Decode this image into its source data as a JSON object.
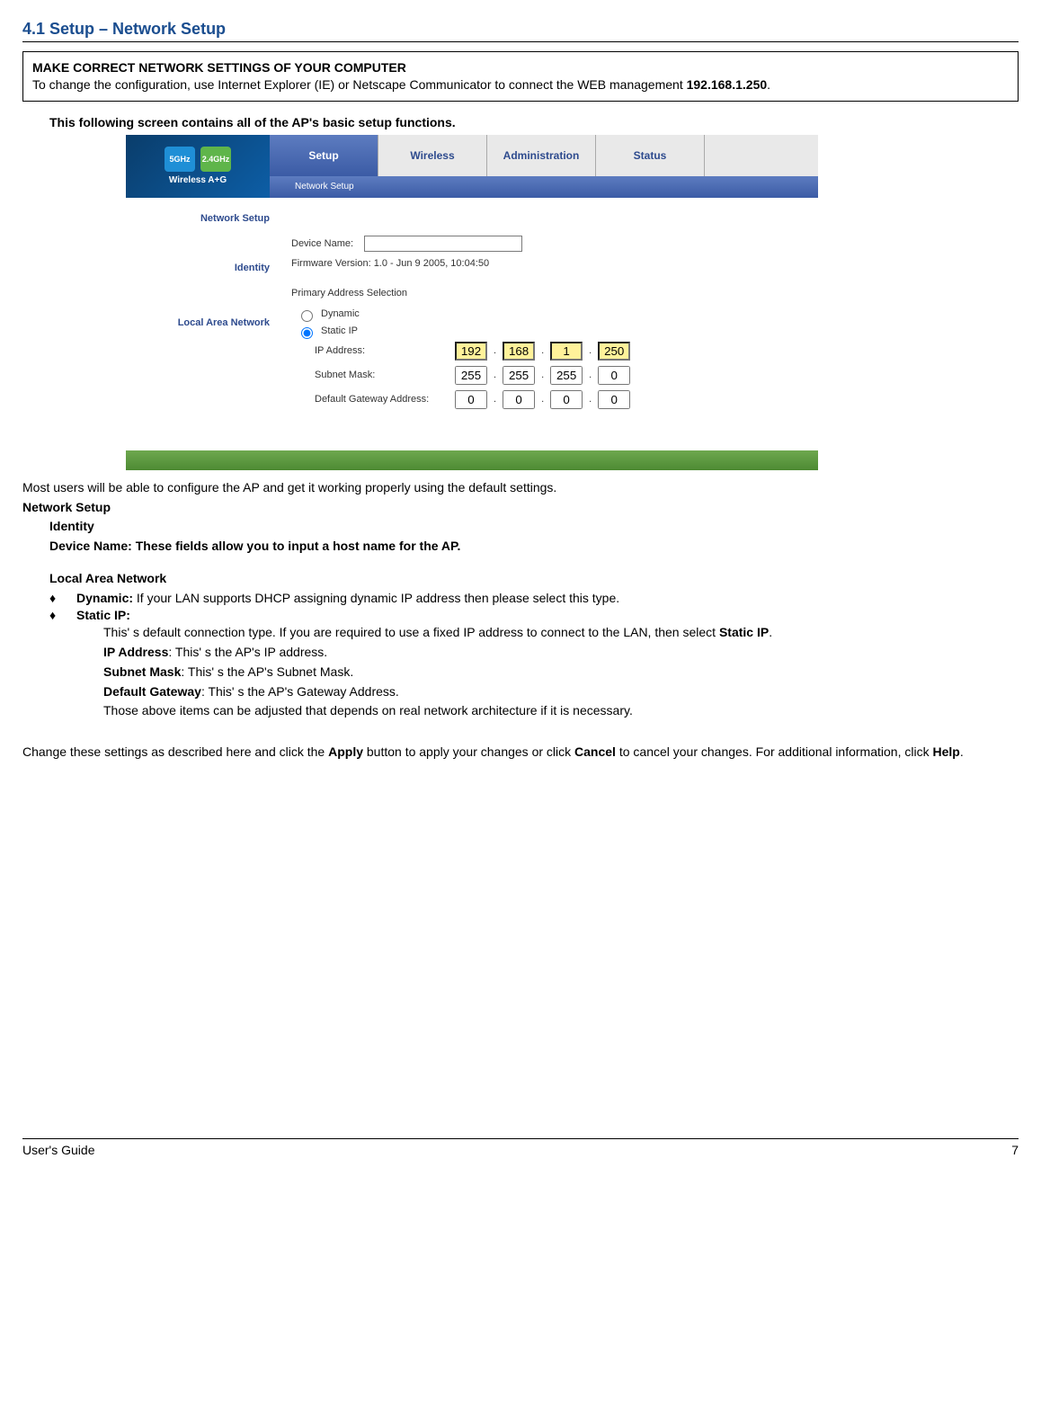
{
  "section_title": "4.1 Setup – Network Setup",
  "notice": {
    "heading": "MAKE CORRECT NETWORK SETTINGS OF YOUR COMPUTER",
    "body_pre": "To change the configuration, use Internet Explorer (IE) or Netscape Communicator to connect the WEB management ",
    "ip": "192.168.1.250",
    "body_post": "."
  },
  "intro_bold": "This following screen contains all of the AP's basic setup functions.",
  "ui": {
    "logo": {
      "flag1": "5GHz",
      "flag2": "2.4GHz",
      "txt": "Wireless A+G"
    },
    "tabs": {
      "setup": "Setup",
      "wireless": "Wireless",
      "admin": "Administration",
      "status": "Status"
    },
    "subtab": "Network Setup",
    "left": {
      "ns": "Network Setup",
      "id": "Identity",
      "lan": "Local Area Network"
    },
    "fields": {
      "device_name_lbl": "Device Name:",
      "fw_lbl": "Firmware Version: 1.0 - Jun 9 2005, 10:04:50",
      "pas": "Primary Address Selection",
      "dyn": "Dynamic",
      "stat": "Static IP",
      "ip_lbl": "IP Address:",
      "sm_lbl": "Subnet Mask:",
      "gw_lbl": "Default Gateway Address:",
      "ip": {
        "a": "192",
        "b": "168",
        "c": "1",
        "d": "250"
      },
      "sm": {
        "a": "255",
        "b": "255",
        "c": "255",
        "d": "0"
      },
      "gw": {
        "a": "0",
        "b": "0",
        "c": "0",
        "d": "0"
      }
    }
  },
  "below": {
    "l1": "Most users will be able to configure the AP and get it working properly using the default settings.",
    "ns": "Network Setup",
    "identity": "Identity",
    "dn_line": "Device Name: These fields allow you to input a host name for the AP.",
    "lan": "Local Area Network",
    "dyn_lbl": "Dynamic:",
    "dyn_txt": " If your LAN supports DHCP assigning dynamic IP address then please select this type.",
    "stat_lbl": "Static IP:",
    "stat_p1a": "This' s default connection type. If you are required to use a fixed IP address to connect to the LAN, then select ",
    "stat_p1b": "Static IP",
    "stat_p1c": ".",
    "ip_b": "IP Address",
    "ip_t": ": This' s the AP's IP address.",
    "sm_b": "Subnet Mask",
    "sm_t": ": This' s the AP's Subnet Mask.",
    "gw_b": "Default Gateway",
    "gw_t": ": This' s the AP's Gateway Address.",
    "adj": "Those above items can be adjusted that depends on real network architecture if it is necessary.",
    "apply_pre": "Change these settings as described here and click the ",
    "apply": "Apply",
    "apply_mid": " button to apply your changes or click ",
    "cancel": "Cancel",
    "apply_post1": " to cancel your changes. For additional information, click ",
    "help": "Help",
    "apply_post2": "."
  },
  "footer": {
    "left": "User's Guide",
    "right": "7"
  }
}
